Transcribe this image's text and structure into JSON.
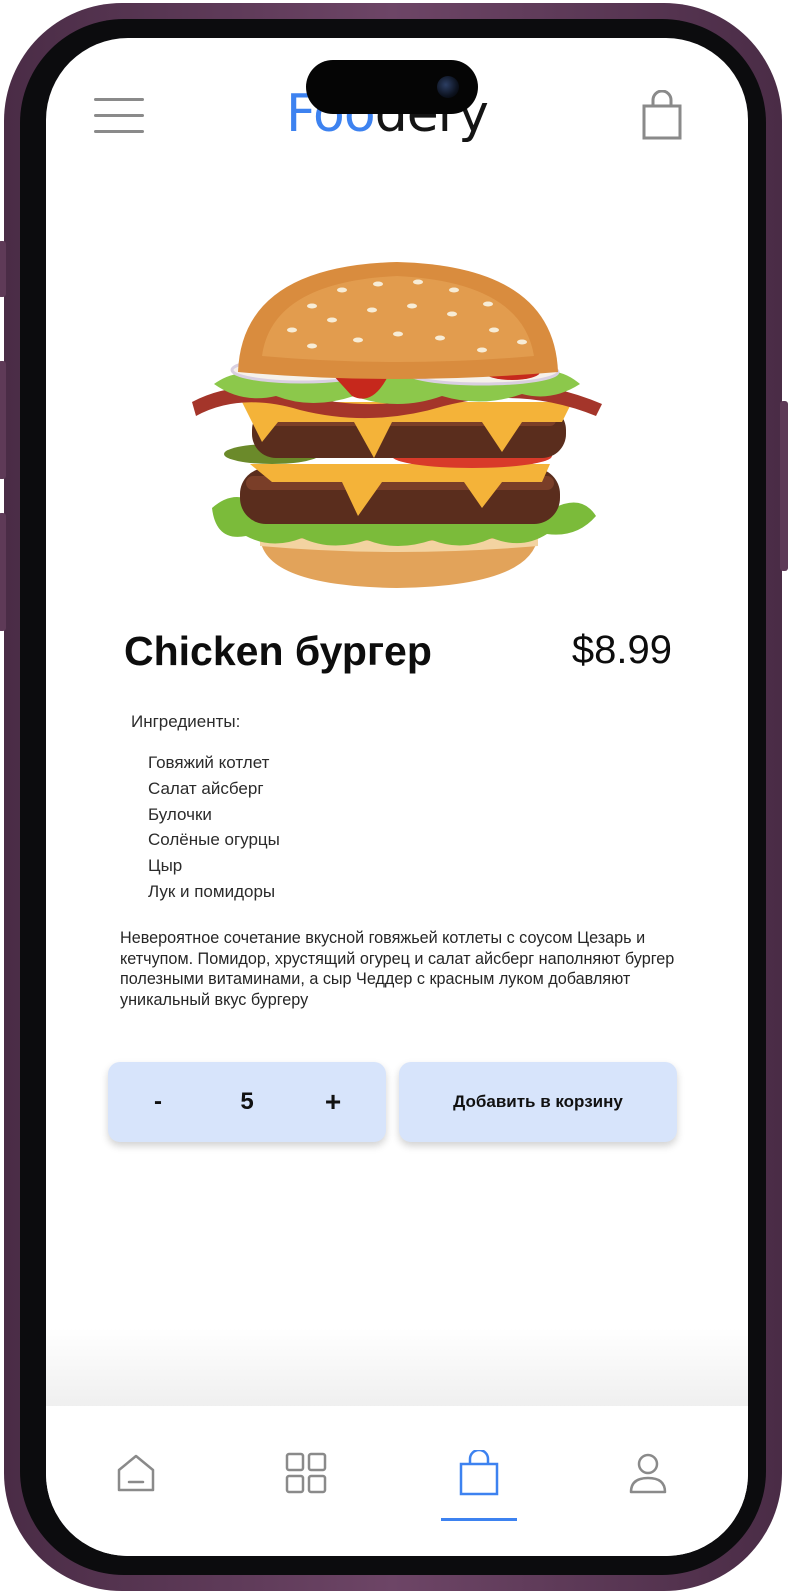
{
  "app": {
    "logo_accent": "Foo",
    "logo_rest": "dery",
    "accent_color": "#3d82f0"
  },
  "product": {
    "name": "Chicken бургер",
    "price": "$8.99",
    "ingredients_title": "Ингредиенты:",
    "ingredients": [
      "Говяжий котлет",
      "Салат айсберг",
      "Булочки",
      "Солёные огурцы",
      "Цыр",
      "Лук и помидоры"
    ],
    "description": "Невероятное сочетание вкусной говяжьей котлеты с соусом Цезарь и  кетчупом. Помидор, хрустящий огурец и салат айсберг наполняют бургер  полезными витаминами, а сыр Чеддер с красным луком добавляют уникальный  вкус бургеру"
  },
  "actions": {
    "qty_minus": "-",
    "qty_value": "5",
    "qty_plus": "+",
    "add_to_cart": "Добавить в корзину"
  },
  "nav": {
    "items": [
      {
        "icon": "home-icon"
      },
      {
        "icon": "grid-icon"
      },
      {
        "icon": "bag-icon",
        "active": true
      },
      {
        "icon": "profile-icon"
      }
    ]
  }
}
